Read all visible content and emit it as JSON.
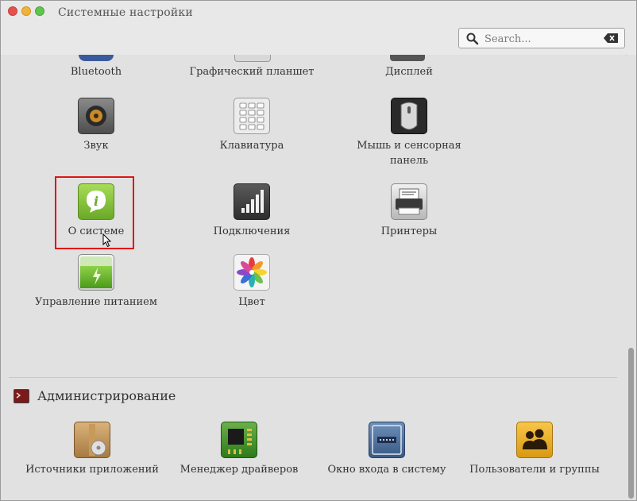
{
  "window": {
    "title": "Системные настройки"
  },
  "search": {
    "placeholder": "Search..."
  },
  "top_row": [
    "Bluetooth",
    "Графический планшет",
    "Дисплей"
  ],
  "hardware": [
    {
      "label": "Звук",
      "icon": "speaker-icon"
    },
    {
      "label": "Клавиатура",
      "icon": "keyboard-icon"
    },
    {
      "label": "Мышь и сенсорная панель",
      "icon": "mouse-icon"
    },
    {
      "label": "О системе",
      "icon": "info-icon"
    },
    {
      "label": "Подключения",
      "icon": "network-bars-icon"
    },
    {
      "label": "Принтеры",
      "icon": "printer-icon"
    },
    {
      "label": "Управление питанием",
      "icon": "battery-icon"
    },
    {
      "label": "Цвет",
      "icon": "color-icon"
    }
  ],
  "admin": {
    "title": "Администрирование",
    "items": [
      {
        "label": "Источники приложений",
        "icon": "package-icon"
      },
      {
        "label": "Менеджер драйверов",
        "icon": "chip-icon"
      },
      {
        "label": "Окно входа в систему",
        "icon": "login-window-icon"
      },
      {
        "label": "Пользователи и группы",
        "icon": "users-icon"
      }
    ]
  },
  "colors": {
    "highlight": "#e01414",
    "info_green": "#8cc83c"
  }
}
